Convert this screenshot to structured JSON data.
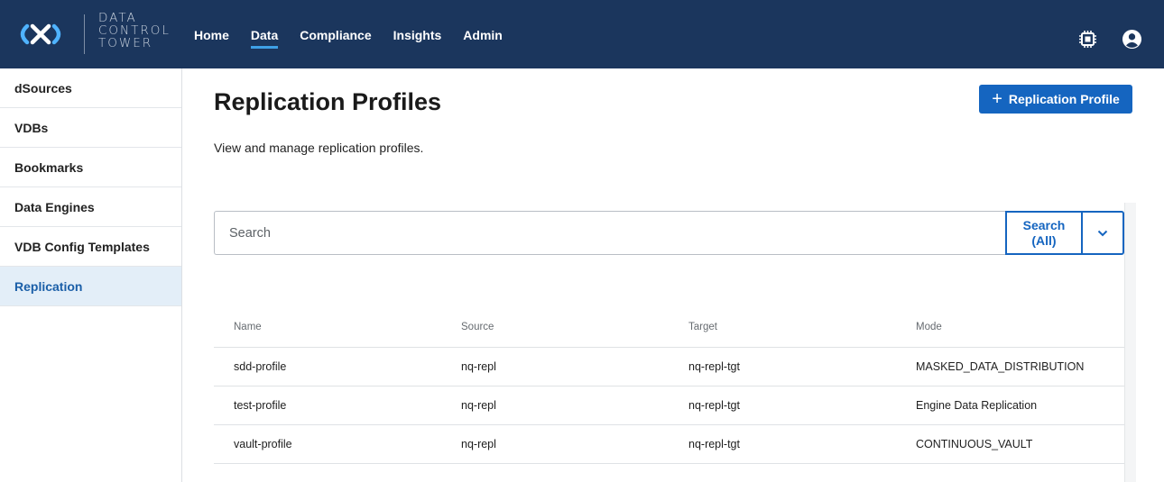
{
  "logo": {
    "icon": "infinity-logo-icon",
    "lines": [
      "DATA",
      "CONTROL",
      "TOWER"
    ]
  },
  "nav": {
    "items": [
      {
        "label": "Home",
        "active": false
      },
      {
        "label": "Data",
        "active": true
      },
      {
        "label": "Compliance",
        "active": false
      },
      {
        "label": "Insights",
        "active": false
      },
      {
        "label": "Admin",
        "active": false
      }
    ],
    "icons": [
      "chip-icon",
      "user-icon"
    ]
  },
  "sidebar": {
    "items": [
      {
        "label": "dSources",
        "active": false
      },
      {
        "label": "VDBs",
        "active": false
      },
      {
        "label": "Bookmarks",
        "active": false
      },
      {
        "label": "Data Engines",
        "active": false
      },
      {
        "label": "VDB Config Templates",
        "active": false
      },
      {
        "label": "Replication",
        "active": true
      }
    ]
  },
  "main": {
    "title": "Replication Profiles",
    "description": "View and manage replication profiles.",
    "add_button_label": "Replication Profile",
    "add_button_icon": "plus-icon"
  },
  "search": {
    "placeholder": "Search",
    "value": "",
    "scope_label_line1": "Search",
    "scope_label_line2": "(All)",
    "dropdown_icon": "chevron-down-icon"
  },
  "table": {
    "columns": [
      "Name",
      "Source",
      "Target",
      "Mode"
    ],
    "rows": [
      [
        "sdd-profile",
        "nq-repl",
        "nq-repl-tgt",
        "MASKED_DATA_DISTRIBUTION"
      ],
      [
        "test-profile",
        "nq-repl",
        "nq-repl-tgt",
        "Engine Data Replication"
      ],
      [
        "vault-profile",
        "nq-repl",
        "nq-repl-tgt",
        "CONTINUOUS_VAULT"
      ]
    ]
  },
  "colors": {
    "header_bg": "#1b365d",
    "accent": "#1565c0",
    "active_underline": "#3ea0e6",
    "sidebar_active_bg": "#e3eef8"
  }
}
